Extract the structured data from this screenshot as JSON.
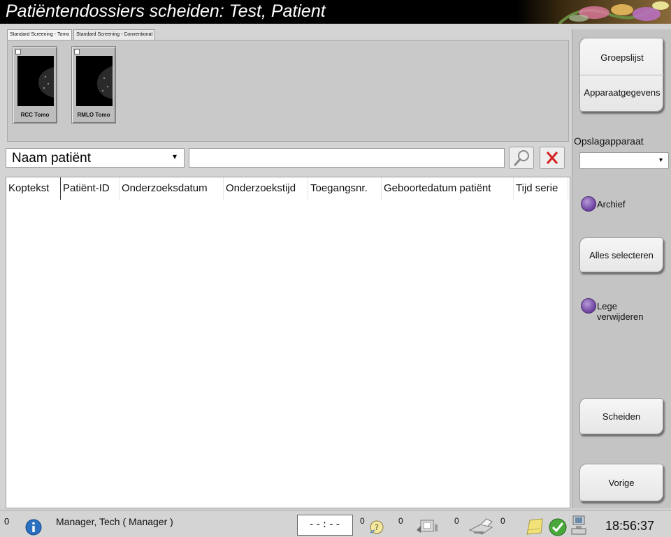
{
  "window": {
    "title": "Patiëntendossiers scheiden: Test, Patient"
  },
  "tabs": [
    {
      "label": "Standard Screening - Tomo",
      "active": true
    },
    {
      "label": "Standard Screening - Conventional",
      "active": false
    }
  ],
  "thumbnails": [
    {
      "label": "RCC Tomo"
    },
    {
      "label": "RMLO Tomo"
    }
  ],
  "search": {
    "field_selected": "Naam patiënt",
    "value": ""
  },
  "table": {
    "columns": [
      "Koptekst",
      "Patiënt-ID",
      "Onderzoeksdatum",
      "Onderzoekstijd",
      "Toegangsnr.",
      "Geboortedatum patiënt",
      "Tijd serie"
    ],
    "rows": []
  },
  "sidebar": {
    "group_list_label": "Groepslijst",
    "device_info_label": "Apparaatgegevens",
    "storage_device_label": "Opslagapparaat",
    "storage_device_value": "",
    "archive_label": "Archief",
    "select_all_label": "Alles selecteren",
    "remove_empty_label": "Lege verwijderen",
    "split_label": "Scheiden",
    "previous_label": "Vorige"
  },
  "statusbar": {
    "alerts_count": "0",
    "user": "Manager, Tech ( Manager )",
    "timer": "--:--",
    "queue_counts": [
      "0",
      "0",
      "0",
      "0"
    ],
    "clock": "18:56:37"
  },
  "colors": {
    "title_bg": "#000000",
    "radio_purple": "#7a4aa8",
    "clear_red": "#d42020"
  }
}
